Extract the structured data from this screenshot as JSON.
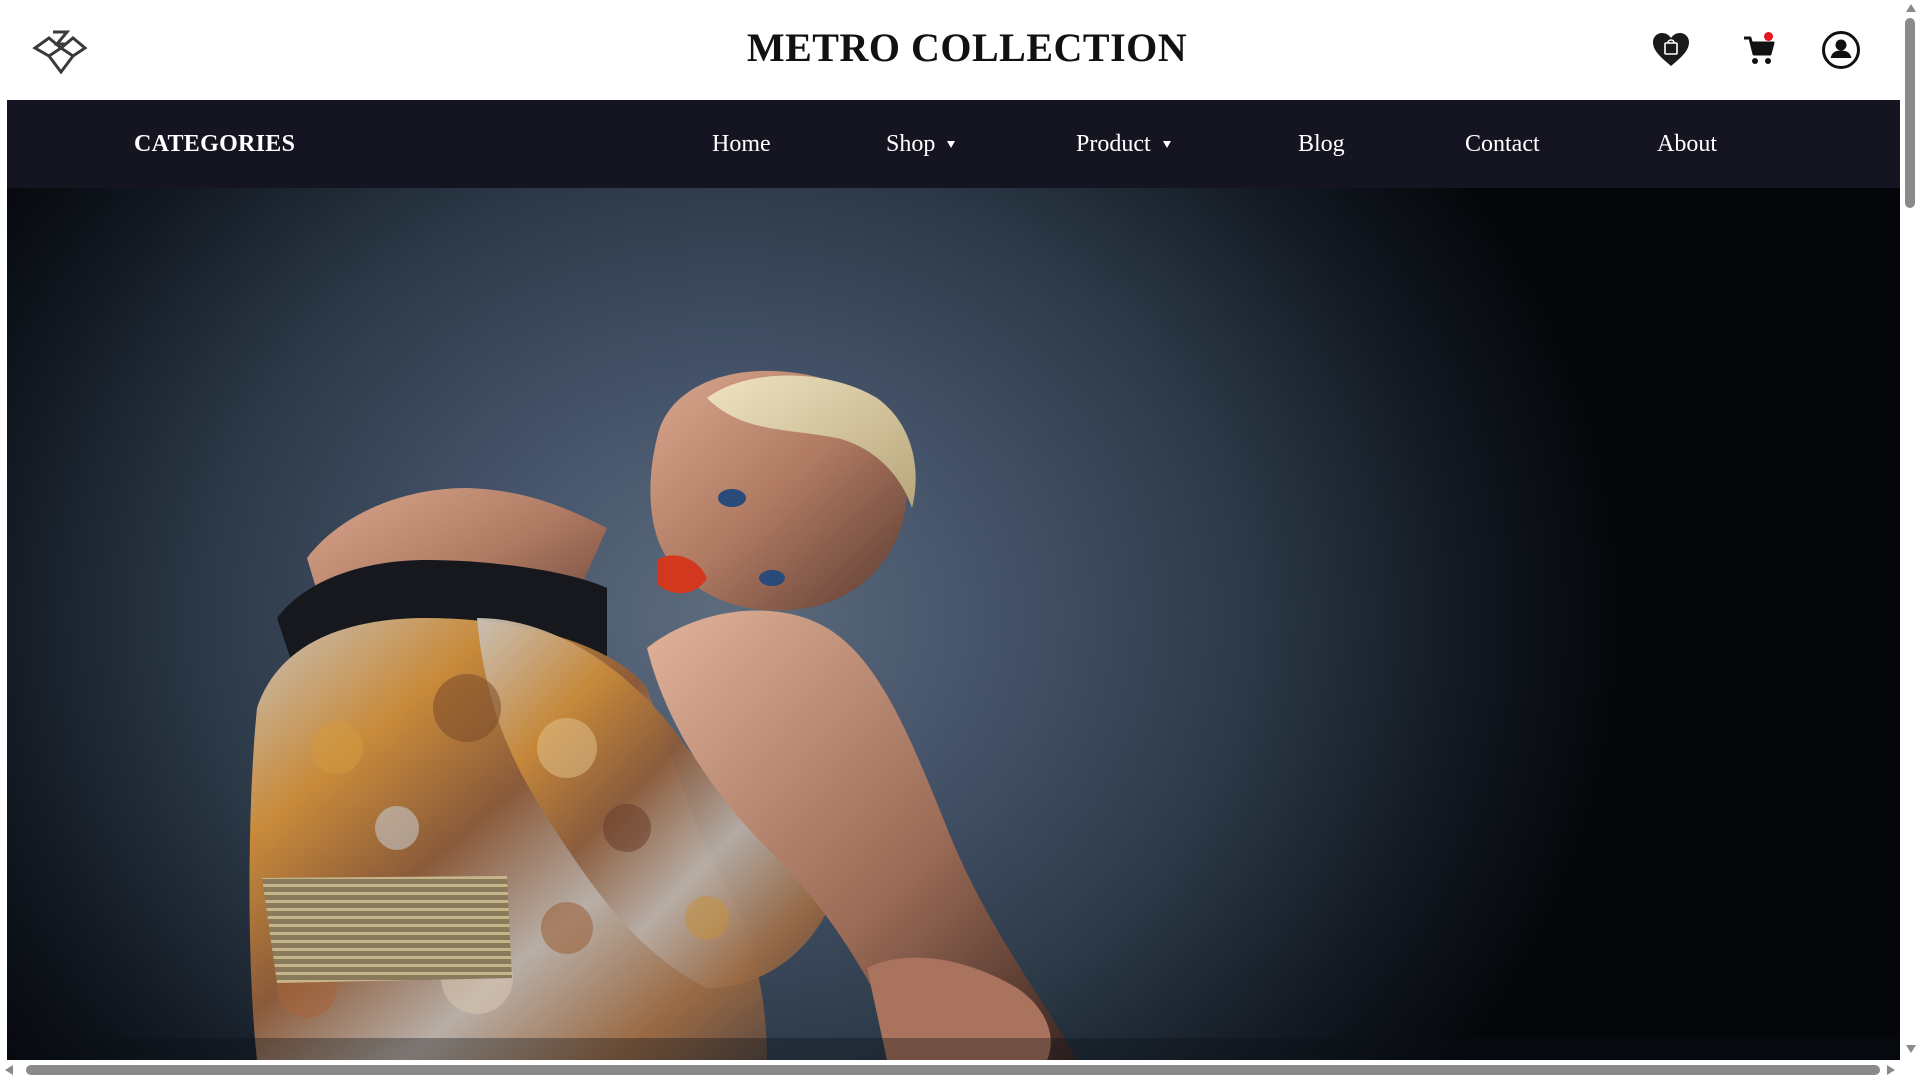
{
  "header": {
    "site_title": "METRO COLLECTION",
    "logo_icon": "winged-emblem-icon",
    "wishlist_icon": "heart-bag-icon",
    "cart_icon": "shopping-cart-icon",
    "account_icon": "user-circle-icon",
    "cart_badge_color": "#e8141c"
  },
  "nav": {
    "categories_label": "CATEGORIES",
    "items": [
      {
        "label": "Home",
        "has_dropdown": false
      },
      {
        "label": "Shop",
        "has_dropdown": true
      },
      {
        "label": "Product",
        "has_dropdown": true
      },
      {
        "label": "Blog",
        "has_dropdown": false
      },
      {
        "label": "Contact",
        "has_dropdown": false
      },
      {
        "label": "About",
        "has_dropdown": false
      }
    ],
    "background_color": "#151522"
  },
  "hero": {
    "image_subject": "fashion-model-floral-dress-photo"
  }
}
